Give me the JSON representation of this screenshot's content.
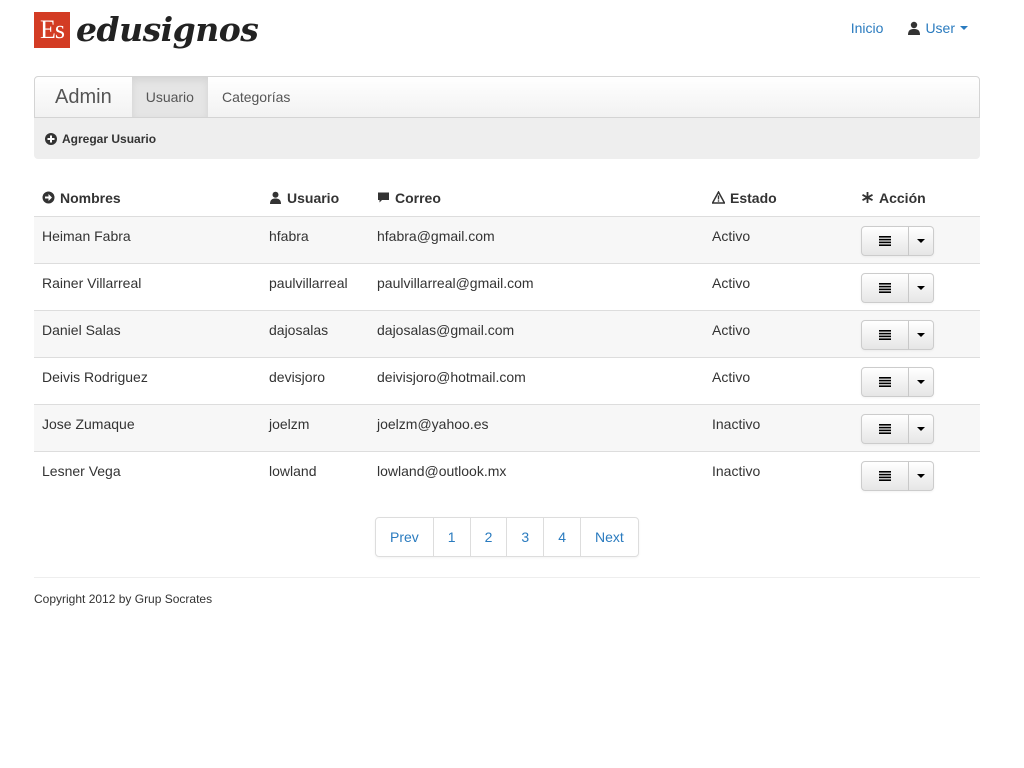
{
  "brand": {
    "logo_mark": "Es",
    "logo_text": "edusignos",
    "logo_color": "#d33c24"
  },
  "top_nav": {
    "home_label": "Inicio",
    "user_label": "User",
    "link_color": "#2a7bbf"
  },
  "admin_nav": {
    "brand": "Admin",
    "tabs": [
      {
        "label": "Usuario",
        "active": true
      },
      {
        "label": "Categorías",
        "active": false
      }
    ]
  },
  "toolbar": {
    "add_user_label": "Agregar Usuario"
  },
  "table": {
    "headers": [
      {
        "label": "Nombres",
        "icon": "arrow-right-circle-icon"
      },
      {
        "label": "Usuario",
        "icon": "user-icon"
      },
      {
        "label": "Correo",
        "icon": "comment-icon"
      },
      {
        "label": "Estado",
        "icon": "warning-icon"
      },
      {
        "label": "Acción",
        "icon": "asterisk-icon"
      }
    ],
    "rows": [
      {
        "nombre": "Heiman Fabra",
        "usuario": "hfabra",
        "correo": "hfabra@gmail.com",
        "estado": "Activo"
      },
      {
        "nombre": "Rainer Villarreal",
        "usuario": "paulvillarreal",
        "correo": "paulvillarreal@gmail.com",
        "estado": "Activo"
      },
      {
        "nombre": "Daniel Salas",
        "usuario": "dajosalas",
        "correo": "dajosalas@gmail.com",
        "estado": "Activo"
      },
      {
        "nombre": "Deivis Rodriguez",
        "usuario": "devisjoro",
        "correo": "deivisjoro@hotmail.com",
        "estado": "Activo"
      },
      {
        "nombre": "Jose Zumaque",
        "usuario": "joelzm",
        "correo": "joelzm@yahoo.es",
        "estado": "Inactivo"
      },
      {
        "nombre": "Lesner Vega",
        "usuario": "lowland",
        "correo": "lowland@outlook.mx",
        "estado": "Inactivo"
      }
    ]
  },
  "pagination": {
    "prev": "Prev",
    "pages": [
      "1",
      "2",
      "3",
      "4"
    ],
    "next": "Next"
  },
  "footer": {
    "copyright": "Copyright 2012 by Grup Socrates"
  }
}
